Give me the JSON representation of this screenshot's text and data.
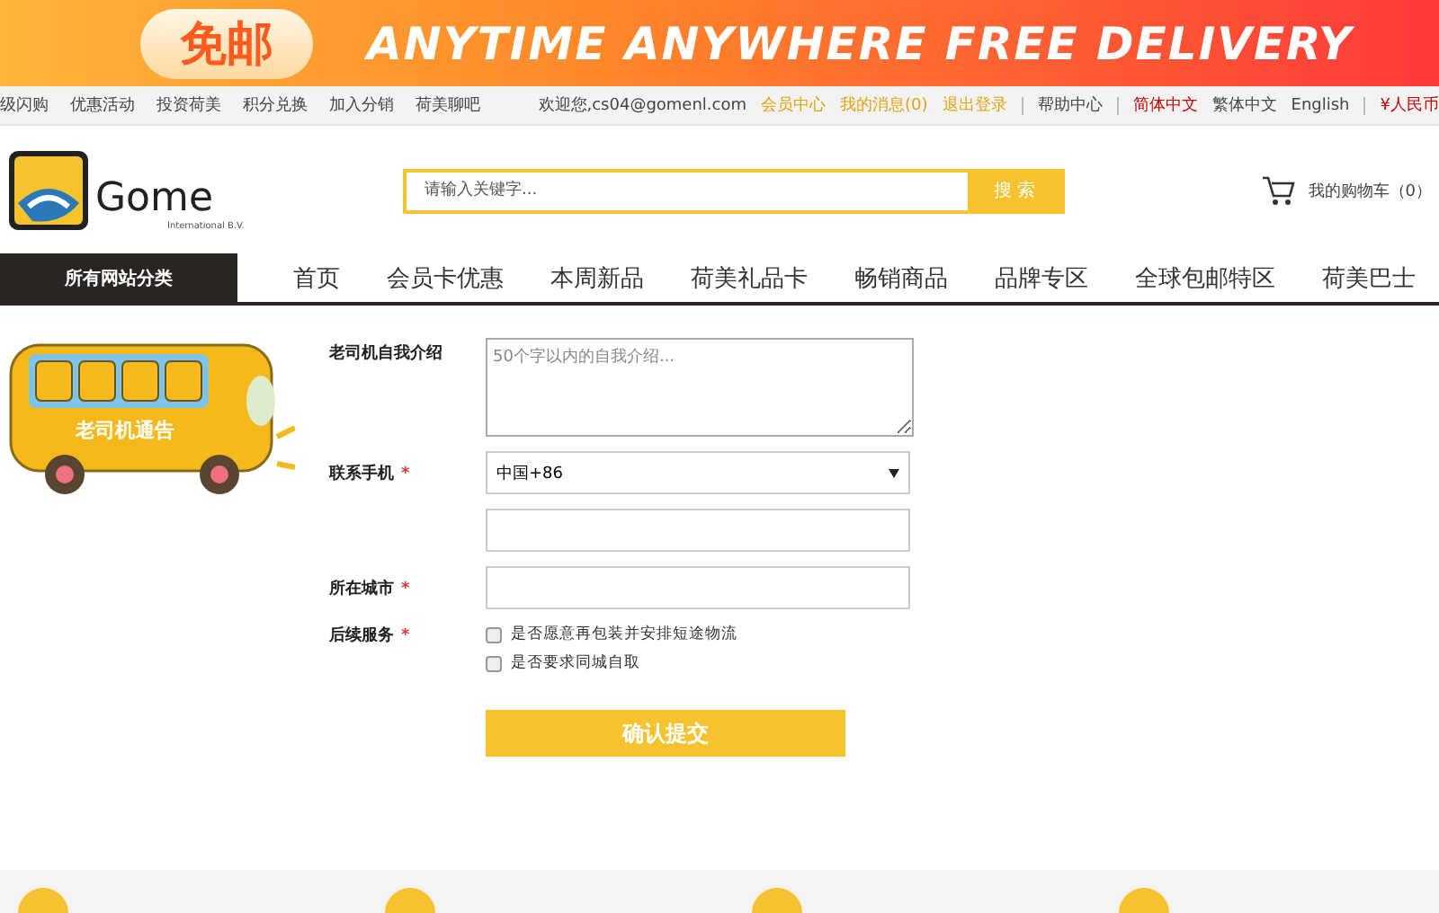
{
  "banner": {
    "badge": "免邮",
    "slogan": "ANYTIME ANYWHERE FREE DELIVERY"
  },
  "top_links": [
    "级闪购",
    "优惠活动",
    "投资荷美",
    "积分兑换",
    "加入分销",
    "荷美聊吧"
  ],
  "account": {
    "welcome": "欢迎您,cs04@gomenl.com",
    "links": [
      "会员中心",
      "我的消息(0)",
      "退出登录"
    ],
    "help": "帮助中心",
    "languages": [
      {
        "label": "简体中文",
        "selected": true
      },
      {
        "label": "繁体中文",
        "selected": false
      },
      {
        "label": "English",
        "selected": false
      }
    ],
    "currency": "¥人民币"
  },
  "logo": {
    "name": "Gome",
    "sub": "International B.V."
  },
  "search": {
    "placeholder": "请输入关键字...",
    "button": "搜 索"
  },
  "cart": {
    "label": "我的购物车（0）"
  },
  "categories": "所有网站分类",
  "nav": [
    "首页",
    "会员卡优惠",
    "本周新品",
    "荷美礼品卡",
    "畅销商品",
    "品牌专区",
    "全球包邮特区",
    "荷美巴士"
  ],
  "bus": {
    "label": "老司机通告"
  },
  "form": {
    "fields": [
      {
        "kind": "textarea",
        "label": "老司机自我介绍",
        "placeholder": "50个字以内的自我介绍..."
      },
      {
        "kind": "select",
        "label": "联系手机",
        "mark": "*",
        "value": "中国+86"
      },
      {
        "kind": "input"
      },
      {
        "kind": "input",
        "label": "所在城市",
        "mark": "*"
      },
      {
        "kind": "checks",
        "label": "后续服务",
        "mark": "*",
        "options": [
          {
            "label": "是否愿意再包装并安排短途物流",
            "checked": false
          },
          {
            "label": "是否要求同城自取",
            "checked": false
          }
        ]
      }
    ],
    "submit": "确认提交"
  },
  "footer": {
    "items": [
      {
        "kind": "service"
      },
      {
        "kind": "service"
      },
      {
        "kind": "service"
      },
      {
        "kind": "service"
      }
    ]
  }
}
